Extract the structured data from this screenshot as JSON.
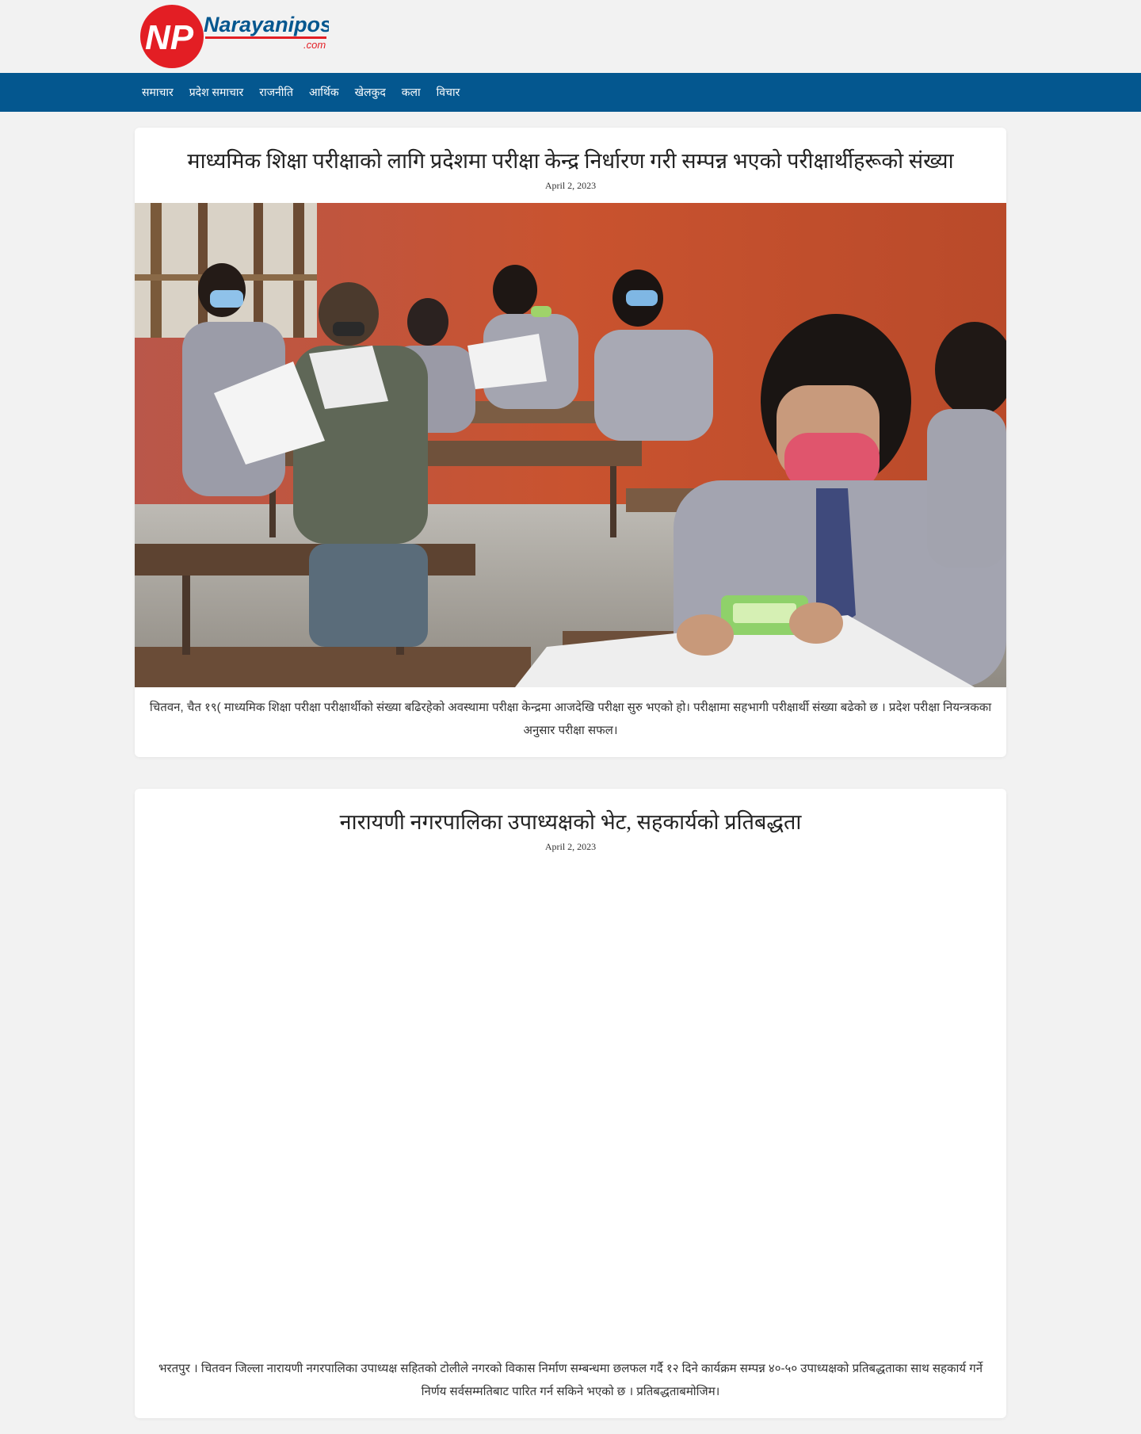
{
  "site": {
    "logo_initials": "NP",
    "logo_name": "Narayanipost",
    "logo_domain": ".com",
    "brand_red": "#e31e24",
    "brand_blue": "#04578f"
  },
  "nav": {
    "items": [
      {
        "label": "समाचार"
      },
      {
        "label": "प्रदेश समाचार"
      },
      {
        "label": "राजनीति"
      },
      {
        "label": "आर्थिक"
      },
      {
        "label": "खेलकुद"
      },
      {
        "label": "कला"
      },
      {
        "label": "विचार"
      }
    ]
  },
  "posts": [
    {
      "title": "माध्यमिक शिक्षा परीक्षाको लागि प्रदेशमा परीक्षा केन्द्र निर्धारण गरी सम्पन्न भएको परीक्षार्थीहरूको संख्या",
      "date": "April 2, 2023",
      "image": "students-writing-exam-photo",
      "excerpt": "चितवन, चैत १९( माध्यमिक शिक्षा परीक्षा परीक्षार्थीको संख्या बढिरहेको अवस्थामा परीक्षा केन्द्रमा आजदेखि परीक्षा सुरु भएको हो। परीक्षामा सहभागी परीक्षार्थी संख्या बढेको छ । प्रदेश परीक्षा नियन्त्रकका अनुसार परीक्षा सफल।"
    },
    {
      "title": "नारायणी नगरपालिका उपाध्यक्षको भेट, सहकार्यको प्रतिबद्धता",
      "date": "April 2, 2023",
      "excerpt": "भरतपुर । चितवन जिल्ला नारायणी नगरपालिका उपाध्यक्ष सहितको टोलीले नगरको विकास निर्माण सम्बन्धमा छलफल गर्दै १२ दिने कार्यक्रम सम्पन्न ४०-५० उपाध्यक्षको प्रतिबद्धताका साथ सहकार्य गर्ने निर्णय सर्वसम्मतिबाट पारित गर्न सकिने भएको छ । प्रतिबद्धताबमोजिम।"
    }
  ]
}
